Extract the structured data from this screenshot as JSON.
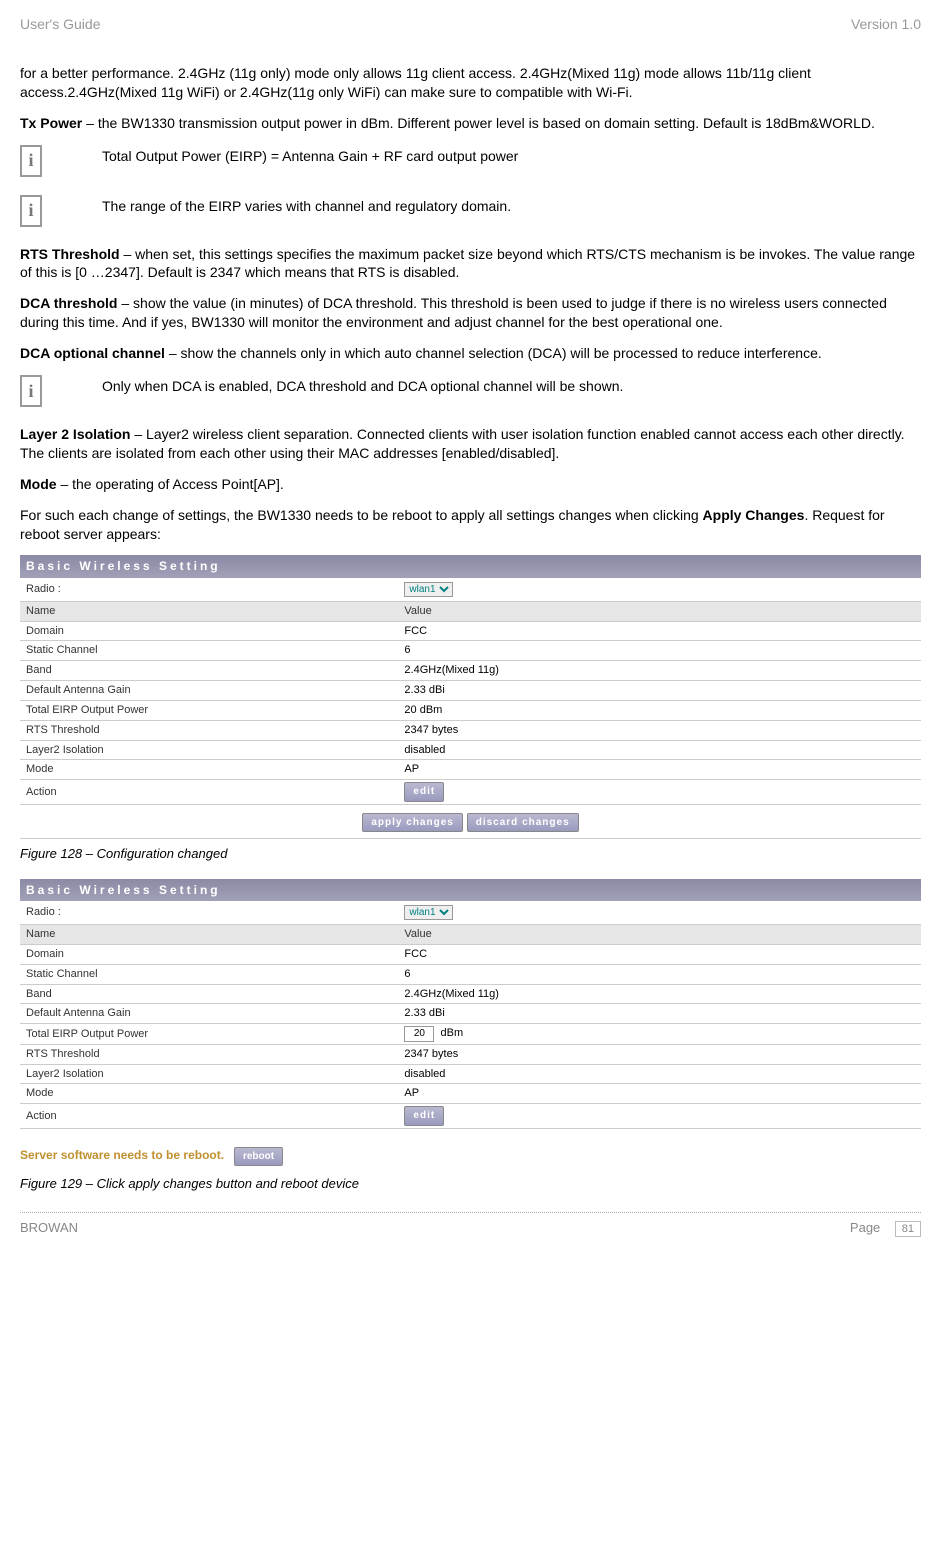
{
  "header": {
    "left": "User's Guide",
    "right": "Version 1.0"
  },
  "intro_para": "for a better performance. 2.4GHz (11g only) mode only allows 11g client access. 2.4GHz(Mixed 11g) mode allows 11b/11g client access.2.4GHz(Mixed 11g WiFi) or 2.4GHz(11g only WiFi) can make sure to compatible with Wi-Fi.",
  "tx_power_label": "Tx Power",
  "tx_power_text": " – the BW1330 transmission output power in dBm. Different power level is based on domain setting. Default is 18dBm&WORLD.",
  "info_eirp": "Total Output Power (EIRP) = Antenna Gain + RF card output power",
  "info_range": "The range of the EIRP varies with channel and regulatory domain.",
  "rts_label": "RTS Threshold",
  "rts_text": " – when set, this settings specifies the maximum packet size beyond which RTS/CTS mechanism is be invokes. The value range of this is [0 …2347]. Default is 2347 which means that RTS is disabled.",
  "dca_thr_label": "DCA threshold",
  "dca_thr_text": " – show the value (in minutes) of DCA threshold. This threshold is been used to judge if there is no wireless users connected during this time. And if yes, BW1330 will monitor the environment and adjust channel for the best operational one.",
  "dca_opt_label": "DCA optional channel",
  "dca_opt_text": " – show the channels only in which auto channel selection (DCA) will be processed to reduce interference.",
  "info_dca": "Only when DCA is enabled, DCA threshold and DCA optional channel will be shown.",
  "layer2_label": "Layer 2 Isolation",
  "layer2_text": " – Layer2 wireless client separation. Connected clients with user isolation function enabled cannot access each other directly. The clients are isolated from each other using their MAC addresses [enabled/disabled].",
  "mode_label": "Mode",
  "mode_text": " – the operating of Access Point[AP].",
  "reboot_para_1": "For such each change of settings, the BW1330 needs to be reboot to apply all settings changes when clicking ",
  "reboot_para_bold": "Apply Changes",
  "reboot_para_2": ". Request for reboot server appears:",
  "ui_title": "Basic Wireless Setting",
  "ui_radio_label": "Radio :",
  "ui_radio_value": "wlan1",
  "ui_name_col": "Name",
  "ui_value_col": "Value",
  "rows1": [
    {
      "k": "Domain",
      "v": "FCC"
    },
    {
      "k": "Static Channel",
      "v": "6"
    },
    {
      "k": "Band",
      "v": "2.4GHz(Mixed 11g)"
    },
    {
      "k": "Default Antenna Gain",
      "v": "2.33 dBi"
    },
    {
      "k": "Total EIRP Output Power",
      "v": "20 dBm"
    },
    {
      "k": "RTS Threshold",
      "v": "2347 bytes"
    },
    {
      "k": "Layer2 Isolation",
      "v": "disabled"
    },
    {
      "k": "Mode",
      "v": "AP"
    }
  ],
  "action_label": "Action",
  "edit_btn": "edit",
  "apply_btn": "apply changes",
  "discard_btn": "discard changes",
  "fig128": "Figure 128 – Configuration changed",
  "rows2_power_value": "20",
  "rows2_power_unit": "dBm",
  "server_reboot_text": "Server software needs to be reboot.",
  "reboot_btn": "reboot",
  "fig129": "Figure 129 – Click apply changes button and reboot device",
  "footer": {
    "left": "BROWAN",
    "page_label": "Page",
    "page_num": "81"
  }
}
